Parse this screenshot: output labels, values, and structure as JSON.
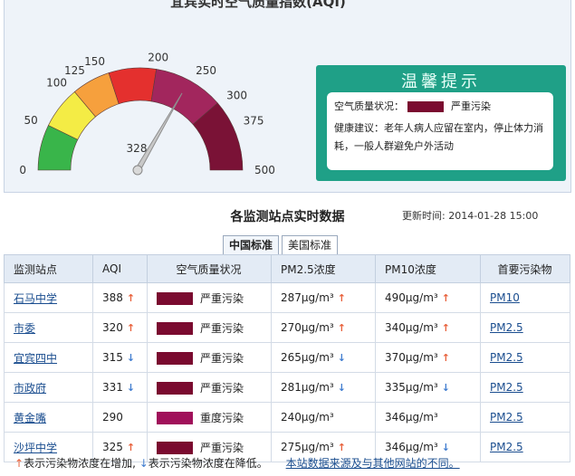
{
  "gauge": {
    "title": "宜宾实时空气质量指数(AQI)",
    "scale_labels": [
      "0",
      "50",
      "100",
      "125",
      "150",
      "200",
      "250",
      "300",
      "375",
      "500"
    ],
    "current_value": "328",
    "colors": [
      "#39b54a",
      "#f4ec45",
      "#f6a03d",
      "#e4302e",
      "#a2265d",
      "#7a1236"
    ]
  },
  "tip": {
    "title": "温馨提示",
    "quality_label": "空气质量状况：",
    "quality_color": "#7a0a2f",
    "quality_value": "严重污染",
    "advice": "健康建议：老年人病人应留在室内，停止体力消耗，一般人群避免户外活动"
  },
  "section": {
    "title": "各监测站点实时数据",
    "update_time": "更新时间: 2014-01-28 15:00"
  },
  "tabs": [
    {
      "label": "中国标准",
      "active": true
    },
    {
      "label": "美国标准",
      "active": false
    }
  ],
  "table": {
    "headers": [
      "监测站点",
      "AQI",
      "空气质量状况",
      "PM2.5浓度",
      "PM10浓度",
      "首要污染物"
    ],
    "rows": [
      {
        "station": "石马中学",
        "aqi": "388",
        "aqi_trend": "up",
        "quality": "严重污染",
        "quality_color": "#7a0a2f",
        "pm25": "287μg/m³",
        "pm25_trend": "up",
        "pm10": "490μg/m³",
        "pm10_trend": "up",
        "primary": "PM10"
      },
      {
        "station": "市委",
        "aqi": "320",
        "aqi_trend": "up",
        "quality": "严重污染",
        "quality_color": "#7a0a2f",
        "pm25": "270μg/m³",
        "pm25_trend": "up",
        "pm10": "340μg/m³",
        "pm10_trend": "up",
        "primary": "PM2.5"
      },
      {
        "station": "宜宾四中",
        "aqi": "315",
        "aqi_trend": "down",
        "quality": "严重污染",
        "quality_color": "#7a0a2f",
        "pm25": "265μg/m³",
        "pm25_trend": "down",
        "pm10": "370μg/m³",
        "pm10_trend": "up",
        "primary": "PM2.5"
      },
      {
        "station": "市政府",
        "aqi": "331",
        "aqi_trend": "down",
        "quality": "严重污染",
        "quality_color": "#7a0a2f",
        "pm25": "281μg/m³",
        "pm25_trend": "down",
        "pm10": "335μg/m³",
        "pm10_trend": "down",
        "primary": "PM2.5"
      },
      {
        "station": "黄金嘴",
        "aqi": "290",
        "aqi_trend": "",
        "quality": "重度污染",
        "quality_color": "#a0105a",
        "pm25": "240μg/m³",
        "pm25_trend": "",
        "pm10": "346μg/m³",
        "pm10_trend": "",
        "primary": "PM2.5"
      },
      {
        "station": "沙坪中学",
        "aqi": "325",
        "aqi_trend": "up",
        "quality": "严重污染",
        "quality_color": "#7a0a2f",
        "pm25": "275μg/m³",
        "pm25_trend": "up",
        "pm10": "346μg/m³",
        "pm10_trend": "down",
        "primary": "PM2.5"
      }
    ]
  },
  "footer": {
    "up_arrow": "↑",
    "up_text": "表示污染物浓度在增加,",
    "down_arrow": "↓",
    "down_text": "表示污染物浓度在降低。",
    "link": "本站数据来源及与其他网站的不同。"
  }
}
